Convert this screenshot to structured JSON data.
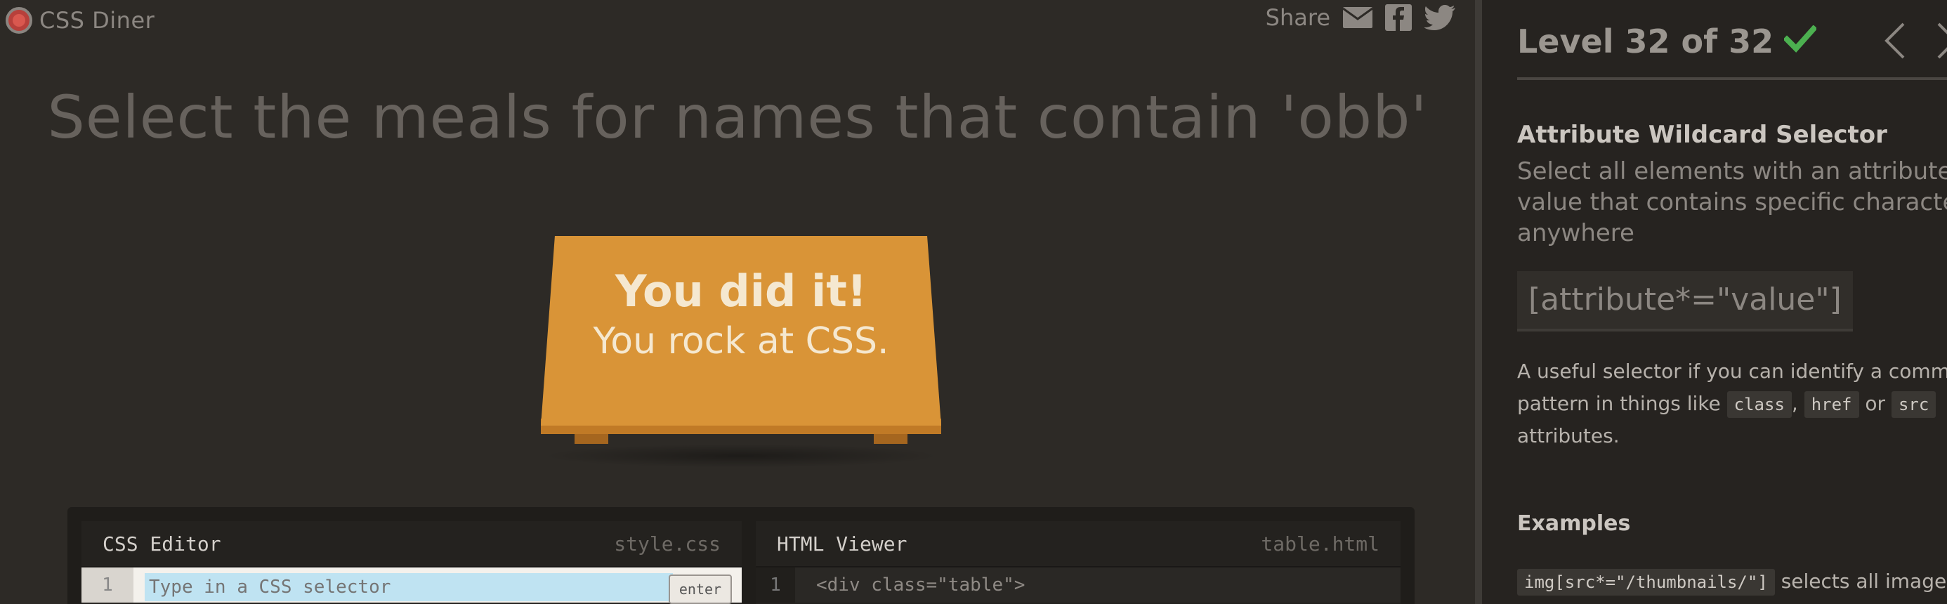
{
  "header": {
    "logo_text": "CSS Diner",
    "share_label": "Share",
    "share_icons": [
      "mail-icon",
      "facebook-icon",
      "twitter-icon"
    ]
  },
  "game": {
    "order_text": "Select the meals for names that contain 'obb'",
    "win_title": "You did it!",
    "win_subtitle": "You rock at CSS."
  },
  "editor": {
    "css_title": "CSS Editor",
    "css_file": "style.css",
    "line_number": "1",
    "css_placeholder": "Type in a CSS selector",
    "enter_label": "enter",
    "html_title": "HTML Viewer",
    "html_file": "table.html",
    "html_line_number": "1",
    "html_code": "<div class=\"table\">"
  },
  "sidebar": {
    "level_text": "Level 32 of 32",
    "completed": true,
    "selector_name": "Attribute Wildcard Selector",
    "selector_title_lines": [
      "Select all elements with an attribute",
      "value that contains specific characters",
      "anywhere"
    ],
    "syntax": "[attribute*=\"value\"]",
    "hint_line1": "A useful selector if you can identify a common",
    "hint_line2_prefix": "pattern in things like",
    "hint_chip_class": "class",
    "hint_sep1": ",",
    "hint_chip_href": "href",
    "hint_or": "or",
    "hint_chip_src": "src",
    "hint_line3": "attributes.",
    "examples_title": "Examples",
    "example_code": "img[src*=\"/thumbnails/\"]",
    "example_text": "selects all images"
  },
  "colors": {
    "background": "#2d2a26",
    "table": "#d99437",
    "check": "#4cb050",
    "sidebar": "#262320"
  }
}
